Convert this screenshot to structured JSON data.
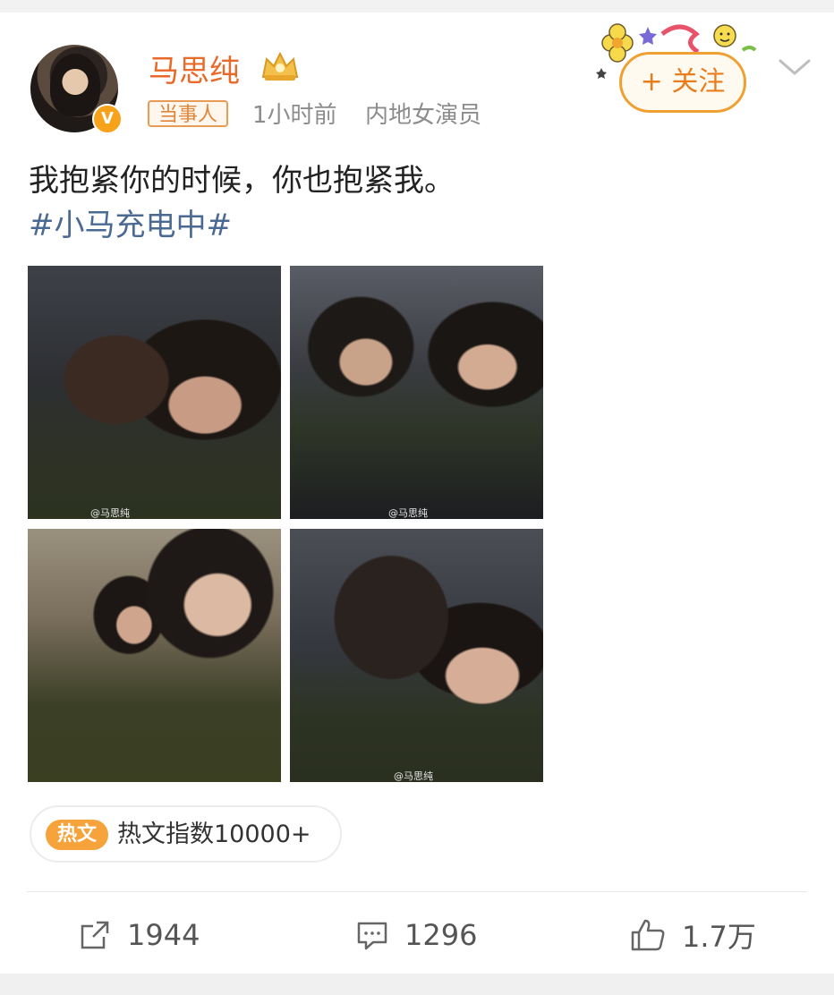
{
  "author": {
    "name": "马思纯",
    "verified_mark": "V",
    "tag": "当事人",
    "time": "1小时前",
    "role": "内地女演员"
  },
  "follow": {
    "label": "+ 关注"
  },
  "post": {
    "text": "我抱紧你的时候，你也抱紧我。",
    "hashtag": "#小马充电中#"
  },
  "photos": [
    {
      "watermark": "@马思纯"
    },
    {
      "watermark": "@马思纯"
    },
    {
      "watermark": ""
    },
    {
      "watermark": "@马思纯"
    }
  ],
  "hot": {
    "icon_label": "热文",
    "text": "热文指数10000+"
  },
  "actions": {
    "repost_count": "1944",
    "comment_count": "1296",
    "like_count": "1.7万"
  },
  "colors": {
    "name": "#e86a2b",
    "hashtag": "#4a6a93",
    "accent": "#f0a032"
  },
  "icons": [
    "crown-icon",
    "chevron-down-icon",
    "share-icon",
    "comment-icon",
    "like-icon"
  ]
}
